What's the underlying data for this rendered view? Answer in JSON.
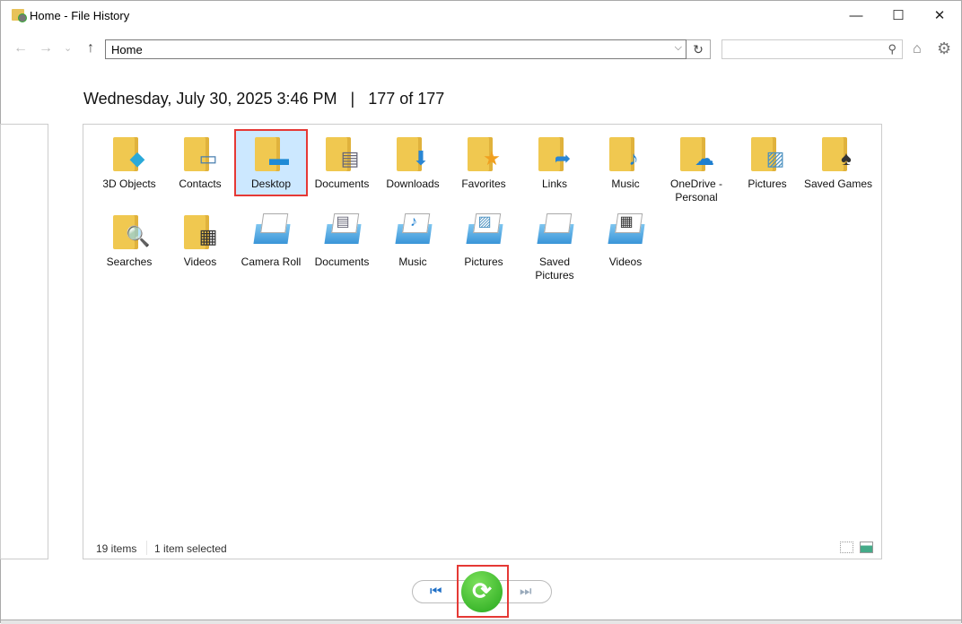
{
  "window": {
    "title": "Home - File History",
    "min": "—",
    "max": "☐",
    "close": "✕"
  },
  "nav": {
    "back": "←",
    "forward": "→",
    "recent": "⌄",
    "up": "↑",
    "address": "Home",
    "refresh": "↻",
    "search_placeholder": ""
  },
  "heading": {
    "date": "Wednesday, July 30, 2025 3:46 PM",
    "separator": "|",
    "position": "177 of 177"
  },
  "items": [
    {
      "label": "3D Objects",
      "type": "folder",
      "glyph": "◆",
      "color": "#2aa9d8"
    },
    {
      "label": "Contacts",
      "type": "folder",
      "glyph": "▭",
      "color": "#4a7fb0"
    },
    {
      "label": "Desktop",
      "type": "folder",
      "glyph": "▬",
      "color": "#1e8ad6",
      "selected": true
    },
    {
      "label": "Documents",
      "type": "folder",
      "glyph": "▤",
      "color": "#667"
    },
    {
      "label": "Downloads",
      "type": "folder",
      "glyph": "⬇",
      "color": "#2a86d4"
    },
    {
      "label": "Favorites",
      "type": "folder",
      "glyph": "★",
      "color": "#f0a020"
    },
    {
      "label": "Links",
      "type": "folder",
      "glyph": "➦",
      "color": "#2a86d4"
    },
    {
      "label": "Music",
      "type": "folder",
      "glyph": "♪",
      "color": "#1e7fd0"
    },
    {
      "label": "OneDrive - Personal",
      "type": "folder",
      "glyph": "☁",
      "color": "#1e7fd0"
    },
    {
      "label": "Pictures",
      "type": "folder",
      "glyph": "▨",
      "color": "#4a90c0"
    },
    {
      "label": "Saved Games",
      "type": "folder",
      "glyph": "♠",
      "color": "#333"
    },
    {
      "label": "Searches",
      "type": "folder",
      "glyph": "🔍",
      "color": "#4a90c0"
    },
    {
      "label": "Videos",
      "type": "folder",
      "glyph": "▦",
      "color": "#333"
    },
    {
      "label": "Camera Roll",
      "type": "library",
      "glyph": "",
      "color": "#3a95d8"
    },
    {
      "label": "Documents",
      "type": "library",
      "glyph": "▤",
      "color": "#667"
    },
    {
      "label": "Music",
      "type": "library",
      "glyph": "♪",
      "color": "#1e7fd0"
    },
    {
      "label": "Pictures",
      "type": "library",
      "glyph": "▨",
      "color": "#4a90c0"
    },
    {
      "label": "Saved Pictures",
      "type": "library",
      "glyph": "",
      "color": "#3a95d8"
    },
    {
      "label": "Videos",
      "type": "library",
      "glyph": "▦",
      "color": "#333"
    }
  ],
  "status": {
    "count": "19 items",
    "selected": "1 item selected"
  },
  "controls": {
    "previous": "⏮",
    "restore": "⟳",
    "next": "⏭"
  }
}
